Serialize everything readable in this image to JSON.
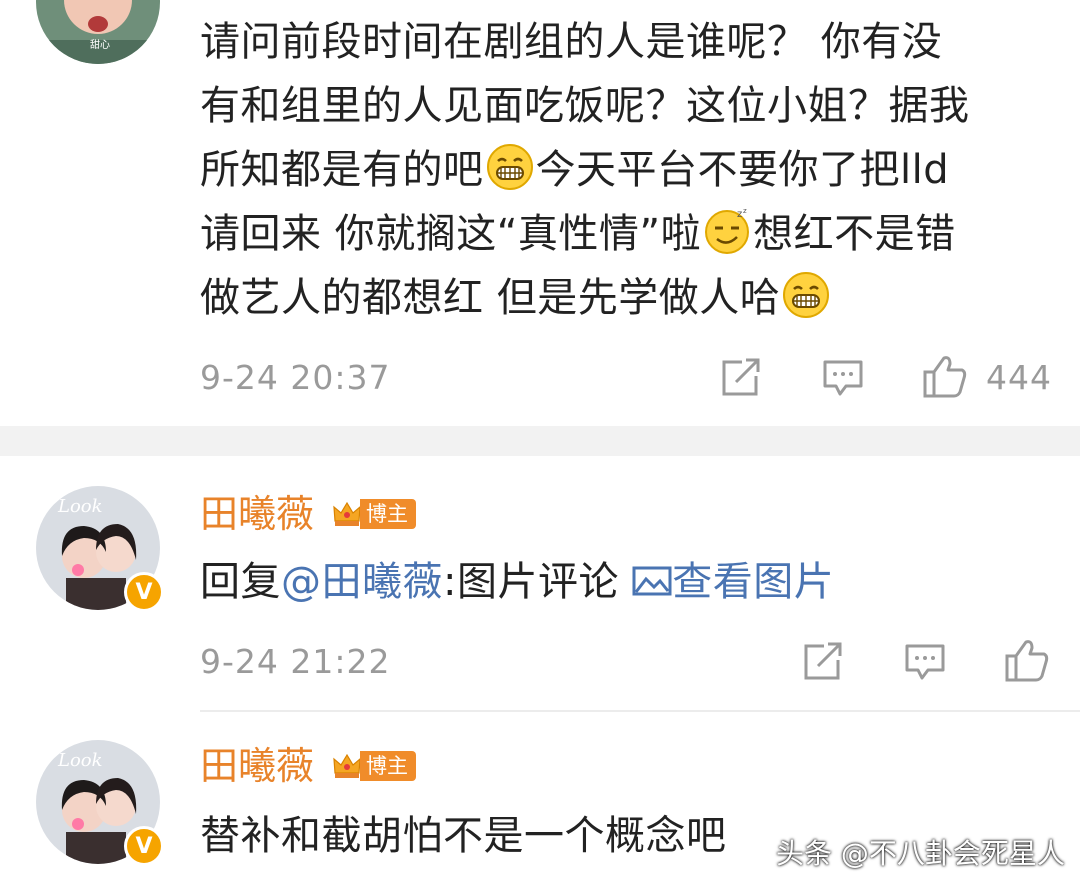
{
  "comment1": {
    "lines": [
      "请问前段时间在剧组的人是谁呢？ 你有没",
      "有和组里的人见面吃饭呢？这位小姐？据我",
      "所知都是有的吧",
      "今天平台不要你了把lld",
      "请回来 你就搁这“真性情”啦",
      "想红不是错",
      "做艺人的都想红 但是先学做人哈"
    ],
    "time": "9-24 20:37",
    "likes": "444",
    "avatar_text": "甜心"
  },
  "comment2": {
    "username": "田曦薇",
    "badge": "博主",
    "reply_prefix": "回复",
    "mention": "@田曦薇",
    "reply_text": ":图片评论",
    "view_image": "查看图片",
    "time": "9-24 21:22",
    "avatar_text": "Look"
  },
  "comment3": {
    "username": "田曦薇",
    "badge": "博主",
    "text": "替补和截胡怕不是一个概念吧",
    "avatar_text": "Look"
  },
  "watermark": "头条 @不八卦会死星人",
  "colors": {
    "username": "#e8832a",
    "link": "#4a74b2",
    "meta": "#9a9a9a",
    "badge": "#f08c2a",
    "verified": "#f6a400"
  }
}
